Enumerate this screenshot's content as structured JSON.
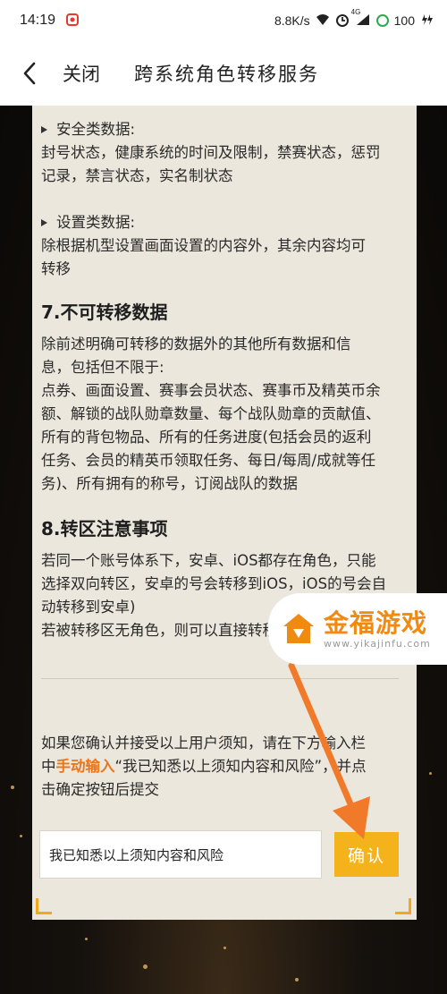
{
  "status_bar": {
    "time": "14:19",
    "network_speed": "8.8K/s",
    "signal_label": "4G",
    "battery": "100"
  },
  "nav": {
    "close_label": "关闭",
    "title": "跨系统角色转移服务"
  },
  "content": {
    "security_heading": "安全类数据:",
    "security_text_1": "封号状态，健康系统的时间及限制，禁赛状态，惩罚",
    "security_text_2": "记录，禁言状态，实名制状态",
    "settings_heading": "设置类数据:",
    "settings_text_1": "除根据机型设置画面设置的内容外，其余内容均可",
    "settings_text_2": "转移",
    "section7_title": "7.不可转移数据",
    "section7_lines": [
      "除前述明确可转移的数据外的其他所有数据和信",
      "息，包括但不限于:",
      "点券、画面设置、赛事会员状态、赛事币及精英币余",
      "额、解锁的战队勋章数量、每个战队勋章的贡献值、",
      "所有的背包物品、所有的任务进度(包括会员的返利",
      "任务、会员的精英币领取任务、每日/每周/成就等任",
      "务)、所有拥有的称号，订阅战队的数据"
    ],
    "section8_title": "8.转区注意事项",
    "section8_lines": [
      "若同一个账号体系下，安卓、iOS都存在角色，只能",
      "选择双向转区，安卓的号会转移到iOS，iOS的号会自",
      "动转移到安卓)",
      "若被转移区无角色，则可以直接转移过去。"
    ]
  },
  "notice": {
    "line1": "如果您确认并接受以上用户须知，请在下方输入栏",
    "line2_prefix": "中",
    "line2_highlight": "手动输入",
    "line2_suffix": "“我已知悉以上须知内容和风险”，并点",
    "line3": "击确定按钮后提交"
  },
  "form": {
    "input_value": "我已知悉以上须知内容和风险",
    "confirm_label": "确认"
  },
  "watermark": {
    "brand": "金福游戏",
    "url": "www.yikajinfu.com"
  },
  "colors": {
    "accent": "#f4b21b",
    "highlight": "#e9761b",
    "arrow": "#f07a2a",
    "panel": "#ece7dd"
  }
}
